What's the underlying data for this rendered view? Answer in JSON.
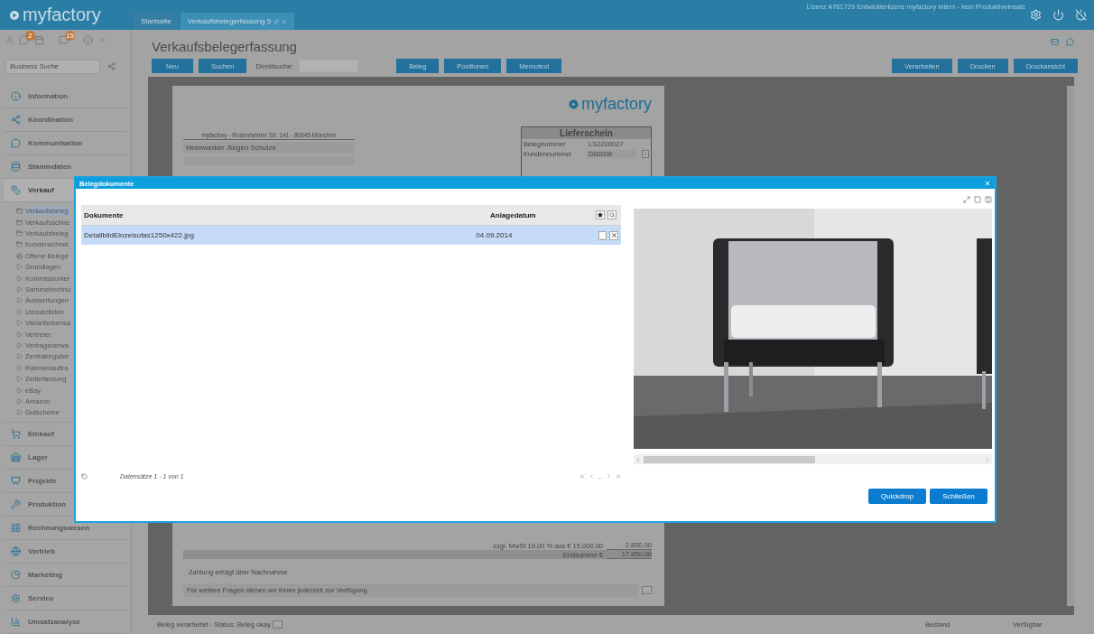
{
  "topbar": {
    "logo": "myfactory",
    "tabs": [
      {
        "label": "Startseite",
        "selected": false
      },
      {
        "label": "Verkaufsbelegerfassung 5",
        "selected": true
      }
    ],
    "license": "Lizenz A761729 Entwicklerlizenz myfactory Intern - kein Produktiveinsatz"
  },
  "sidebar": {
    "badges": [
      "2",
      "15"
    ],
    "search": {
      "placeholder": "Business Suche"
    },
    "items": [
      {
        "label": "Information",
        "expanded": false
      },
      {
        "label": "Koordination",
        "expanded": false
      },
      {
        "label": "Kommunikation",
        "expanded": false
      },
      {
        "label": "Stammdaten",
        "expanded": false
      },
      {
        "label": "Verkauf",
        "expanded": true,
        "children": [
          {
            "label": "Verkaufsbeleg",
            "kind": "page",
            "selected": true
          },
          {
            "label": "Verkaufsschne",
            "kind": "page",
            "selected": false
          },
          {
            "label": "Verkaufsbeleg",
            "kind": "page",
            "selected": false
          },
          {
            "label": "Kundenschnel",
            "kind": "page",
            "selected": false
          },
          {
            "label": "Offene Belege",
            "kind": "print",
            "selected": false
          },
          {
            "label": "Grundlagen",
            "kind": "folder",
            "selected": false
          },
          {
            "label": "Kommissionier",
            "kind": "folder",
            "selected": false
          },
          {
            "label": "Sammelrechnu",
            "kind": "folder",
            "selected": false
          },
          {
            "label": "Auswertungen",
            "kind": "folder",
            "selected": false
          },
          {
            "label": "Umsatzlisten",
            "kind": "folder",
            "selected": false
          },
          {
            "label": "Variantenumsa",
            "kind": "folder",
            "selected": false
          },
          {
            "label": "Vertreter",
            "kind": "folder",
            "selected": false
          },
          {
            "label": "Vertragsverwa",
            "kind": "folder",
            "selected": false
          },
          {
            "label": "Zentralregulier",
            "kind": "folder",
            "selected": false
          },
          {
            "label": "Rahmenauftra",
            "kind": "folder",
            "selected": false
          },
          {
            "label": "Zeiterfassung",
            "kind": "folder",
            "selected": false
          },
          {
            "label": "eBay",
            "kind": "folder",
            "selected": false
          },
          {
            "label": "Amazon",
            "kind": "folder",
            "selected": false
          },
          {
            "label": "Gutscheine",
            "kind": "folder",
            "selected": false
          }
        ]
      },
      {
        "label": "Einkauf",
        "expanded": false
      },
      {
        "label": "Lager",
        "expanded": false
      },
      {
        "label": "Projekte",
        "expanded": false
      },
      {
        "label": "Produktion",
        "expanded": false
      },
      {
        "label": "Rechnungswesen",
        "expanded": false
      },
      {
        "label": "Vertrieb",
        "expanded": false
      },
      {
        "label": "Marketing",
        "expanded": false
      },
      {
        "label": "Service",
        "expanded": false
      },
      {
        "label": "Umsatzanalyse",
        "expanded": false
      }
    ]
  },
  "main": {
    "title": "Verkaufsbelegerfassung",
    "toolbar_left": [
      "Neu",
      "Suchen"
    ],
    "direct_search": {
      "label": "Direktsuche:"
    },
    "toolbar_middle": [
      "Beleg",
      "Positionen",
      "Memotext"
    ],
    "toolbar_right": [
      "Verarbeiten",
      "Drucken",
      "Druckansicht"
    ]
  },
  "document": {
    "logo": "myfactory",
    "sender": "myfactory - Rosenheimer Str. 141 - 80645 München",
    "recipient": "Heimwerker Jürgen Schulze",
    "box_title": "Lieferschein",
    "fields": [
      {
        "label": "Belegnummer",
        "value": "LS2200027"
      },
      {
        "label": "Kundennummer",
        "value": "D00008",
        "button": "!"
      }
    ],
    "totals": [
      {
        "label": "zzgl. MwSt 19,00 % aus € 15.000,00",
        "value": "2.850,00",
        "kind": "plain"
      },
      {
        "label": "Endsumme €",
        "value": "17.850,00",
        "kind": "band"
      }
    ],
    "payment": "Zahlung erfolgt über Nachnahme",
    "closing": "Für weitere Fragen stehen wir Ihnen jederzeit zur Verfügung.",
    "closing_button": "..."
  },
  "status_bar": {
    "status": "Beleg verarbeitet - Status: Beleg okay",
    "button": "...",
    "columns": [
      "Bestand",
      "Verfügbar"
    ]
  },
  "dialog": {
    "title": "Belegdokumente",
    "table": {
      "columns": [
        "Dokumente",
        "Anlagedatum"
      ],
      "rows": [
        {
          "cells": [
            "DetailbildEinzelsofas1250x422.jpg",
            "04.09.2014"
          ],
          "button": "...",
          "selected": true
        }
      ]
    },
    "records": "Datensätze 1 - 1 von 1",
    "pager_ellipsis": "...",
    "preview": {
      "kind": "picture"
    },
    "buttons": [
      "Quickdrop",
      "Schließen"
    ]
  }
}
